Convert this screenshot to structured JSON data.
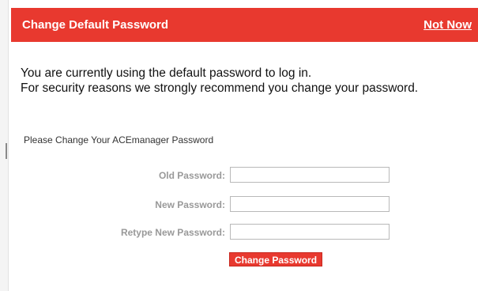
{
  "dialog": {
    "title": "Change Default Password",
    "not_now_label": "Not Now",
    "message_line1": "You are currently using the default password to log in.",
    "message_line2": "For security reasons we strongly recommend you change your password.",
    "subheading": "Please Change Your ACEmanager Password"
  },
  "form": {
    "old_password_label": "Old Password:",
    "new_password_label": "New Password:",
    "retype_password_label": "Retype New Password:",
    "old_password_value": "",
    "new_password_value": "",
    "retype_password_value": "",
    "submit_label": "Change Password"
  },
  "colors": {
    "accent": "#e8392f",
    "label_gray": "#999999"
  }
}
